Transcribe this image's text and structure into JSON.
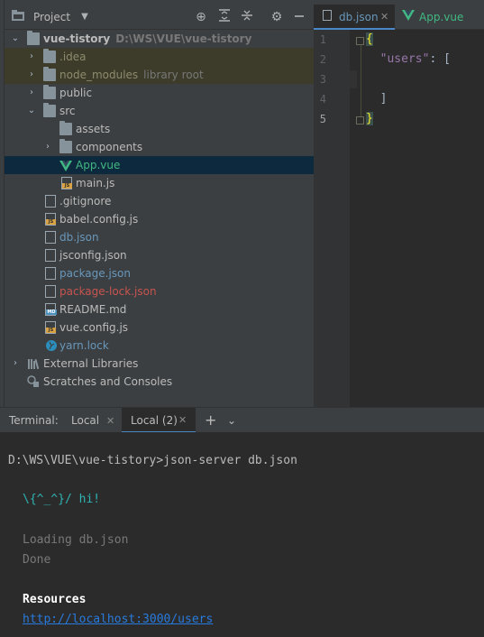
{
  "project_panel": {
    "title": "Project",
    "icons": [
      "crosshair-icon",
      "expand-all-icon",
      "collapse-all-icon",
      "gear-icon",
      "minimize-icon"
    ]
  },
  "tree": {
    "root": {
      "name": "vue-tistory",
      "path": "D:\\WS\\VUE\\vue-tistory"
    },
    "idea": ".idea",
    "node_modules": {
      "name": "node_modules",
      "hint": "library root"
    },
    "public": "public",
    "src": "src",
    "assets": "assets",
    "components": "components",
    "app_vue": "App.vue",
    "main_js": "main.js",
    "gitignore": ".gitignore",
    "babel_config": "babel.config.js",
    "db_json": "db.json",
    "jsconfig": "jsconfig.json",
    "package_json": "package.json",
    "package_lock": "package-lock.json",
    "readme": "README.md",
    "vue_config": "vue.config.js",
    "yarn_lock": "yarn.lock",
    "external_libraries": "External Libraries",
    "scratches": "Scratches and Consoles"
  },
  "editor": {
    "tabs": [
      {
        "label": "db.json"
      },
      {
        "label": "App.vue"
      }
    ],
    "line_numbers": [
      "1",
      "2",
      "3",
      "4",
      "5"
    ],
    "lines": [
      "{",
      "  \"users\": [",
      "",
      "  ]",
      "}"
    ]
  },
  "terminal": {
    "label": "Terminal:",
    "tabs": [
      {
        "label": "Local"
      },
      {
        "label": "Local (2)"
      }
    ],
    "lines": {
      "command": "D:\\WS\\VUE\\vue-tistory>json-server db.json",
      "greeting": "\\{^_^}/ hi!",
      "loading": "Loading db.json",
      "done": "Done",
      "resources": "Resources",
      "url": "http://localhost:3000/users"
    }
  },
  "colors": {
    "panel_bg": "#3c3f41",
    "editor_bg": "#2b2b2b",
    "selected_row": "#0d293e",
    "vue_green": "#41b883",
    "json_blue": "#6897bb",
    "lock_red": "#c75450",
    "link_blue": "#287bde",
    "greeting_teal": "#2fb3b3"
  }
}
